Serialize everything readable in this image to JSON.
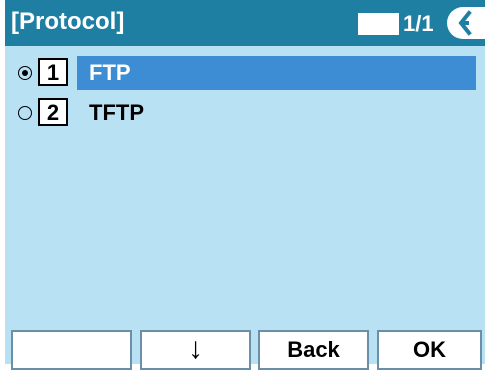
{
  "header": {
    "title": "[Protocol]",
    "page_indicator": "1/1",
    "back_icon": "back-tab-icon"
  },
  "options": [
    {
      "number": "1",
      "label": "FTP",
      "selected": true
    },
    {
      "number": "2",
      "label": "TFTP",
      "selected": false
    }
  ],
  "softkeys": {
    "key1": "",
    "key2": "↓",
    "key3": "Back",
    "key4": "OK"
  },
  "colors": {
    "screen_bg": "#b9e1f4",
    "titlebar": "#1f7fa3",
    "highlight": "#3c8dd3"
  }
}
